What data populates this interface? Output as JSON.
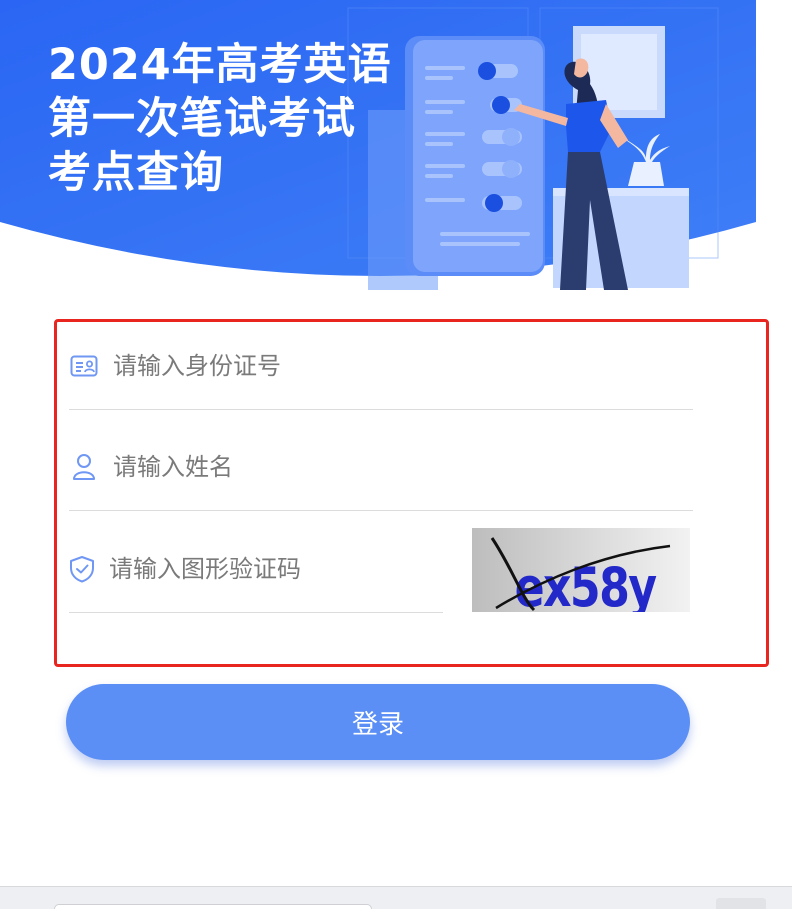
{
  "banner": {
    "title": "2024年高考英语\n第一次笔试考试\n考点查询"
  },
  "form": {
    "id_placeholder": "请输入身份证号",
    "name_placeholder": "请输入姓名",
    "captcha_placeholder": "请输入图形验证码",
    "captcha_text": "ex58y"
  },
  "login": {
    "label": "登录"
  },
  "colors": {
    "banner_blue": "#2f6df5",
    "accent": "#5b8ff5",
    "highlight_border": "#e8251f",
    "captcha_text": "#2328c8"
  }
}
